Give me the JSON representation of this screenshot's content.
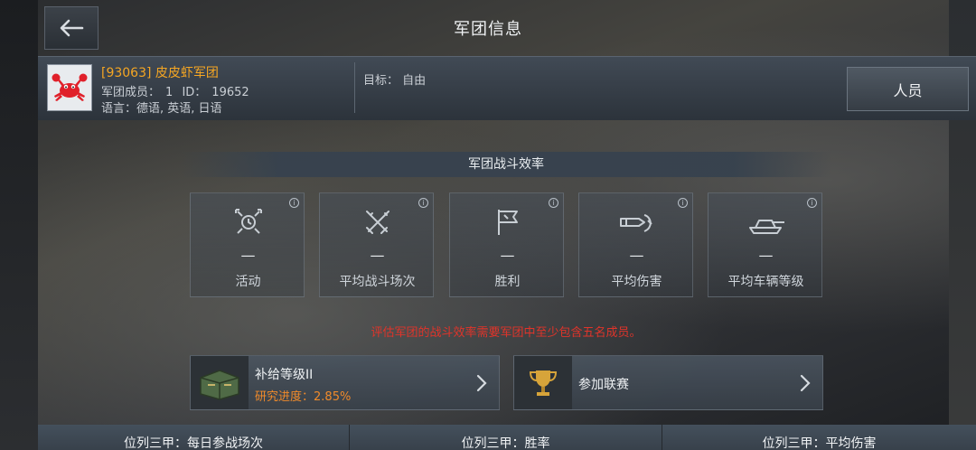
{
  "header": {
    "title": "军团信息"
  },
  "clan": {
    "name": "[93063] 皮皮虾军团",
    "members_label": "军团成员：",
    "members_count": "1",
    "id_label": "ID：",
    "id_value": "19652",
    "lang_label": "语言：",
    "languages": "德语, 英语, 日语",
    "goal_label": "目标：",
    "goal_value": "自由",
    "members_button": "人员"
  },
  "efficiency": {
    "title": "军团战斗效率",
    "stats": [
      {
        "icon": "activity-clock-icon",
        "value": "—",
        "label": "活动"
      },
      {
        "icon": "crossed-swords-icon",
        "value": "—",
        "label": "平均战斗场次"
      },
      {
        "icon": "flag-icon",
        "value": "—",
        "label": "胜利"
      },
      {
        "icon": "shell-damage-icon",
        "value": "—",
        "label": "平均伤害"
      },
      {
        "icon": "tank-icon",
        "value": "—",
        "label": "平均车辆等级"
      }
    ],
    "warning": "评估军团的战斗效率需要军团中至少包含五名成员。"
  },
  "supply": {
    "title": "补给等级II",
    "progress_label": "研究进度：",
    "progress_value": "2.85%",
    "progress_fraction": 0.0285,
    "icon": "supply-crate-icon"
  },
  "league": {
    "title": "参加联赛",
    "icon": "trophy-icon"
  },
  "rankings": {
    "col1": "位列三甲：每日参战场次",
    "col2": "位列三甲：胜率",
    "col3": "位列三甲：平均伤害"
  },
  "colors": {
    "clan_name": "#f5a623",
    "warning": "#e0342a",
    "progress": "#f08a2a",
    "emblem_crab": "#e0202a"
  }
}
